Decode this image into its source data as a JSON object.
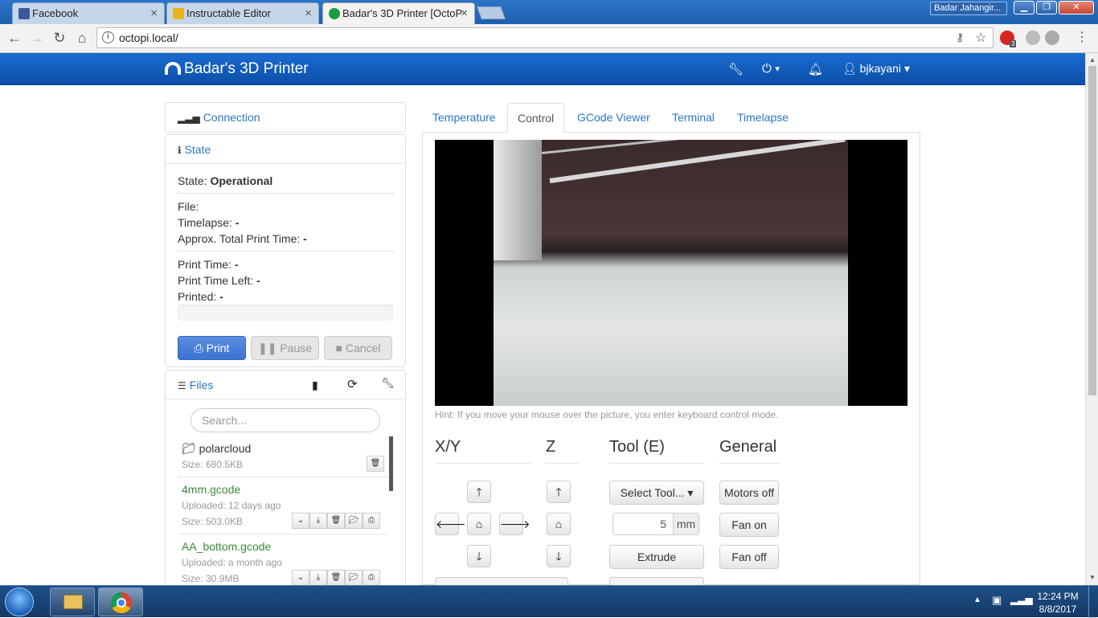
{
  "browser": {
    "tabs": [
      {
        "title": "Facebook"
      },
      {
        "title": "Instructable Editor"
      },
      {
        "title": "Badar's 3D Printer [OctoP"
      }
    ],
    "profile": "Badar Jahangir...",
    "url": "octopi.local/",
    "ext_badge": "3"
  },
  "navbar": {
    "brand": "Badar's 3D Printer",
    "user": "bjkayani"
  },
  "sidebar": {
    "connection_title": "Connection",
    "state_title": "State",
    "state_label": "State:",
    "state_value": "Operational",
    "file_label": "File:",
    "timelapse_label": "Timelapse:",
    "timelapse_value": "-",
    "approx_label": "Approx. Total Print Time:",
    "approx_value": "-",
    "print_time_label": "Print Time:",
    "print_time_value": "-",
    "time_left_label": "Print Time Left:",
    "time_left_value": "-",
    "printed_label": "Printed:",
    "printed_value": "-",
    "progress": 0,
    "print_button": "Print",
    "pause_button": "Pause",
    "cancel_button": "Cancel",
    "files_title": "Files",
    "search_placeholder": "Search...",
    "files": [
      {
        "name": "polarcloud",
        "line1": "Size: 680.5KB"
      },
      {
        "name": "4mm.gcode",
        "line1": "Uploaded: 12 days ago",
        "line2": "Size: 503.0KB"
      },
      {
        "name": "AA_bottom.gcode",
        "line1": "Uploaded: a month ago",
        "line2": "Size: 30.9MB"
      }
    ]
  },
  "main": {
    "tabs": [
      "Temperature",
      "Control",
      "GCode Viewer",
      "Terminal",
      "Timelapse"
    ],
    "hint": "Hint: If you move your mouse over the picture, you enter keyboard control mode.",
    "sections": {
      "xy": "X/Y",
      "z": "Z",
      "tool": "Tool (E)",
      "general": "General"
    },
    "select_tool": "Select Tool...",
    "extrude_amount": "5",
    "extrude_unit": "mm",
    "extrude_button": "Extrude",
    "motors_off": "Motors off",
    "fan_on": "Fan on",
    "fan_off": "Fan off"
  },
  "taskbar": {
    "time": "12:24 PM",
    "date": "8/8/2017"
  }
}
